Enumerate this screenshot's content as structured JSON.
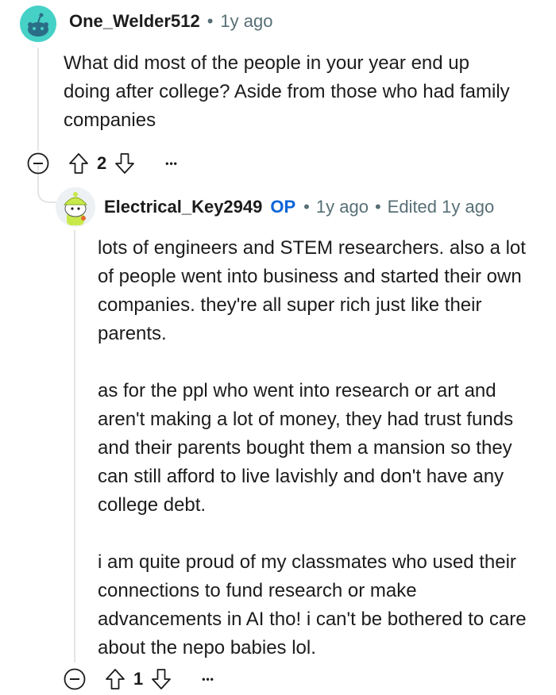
{
  "comment1": {
    "username": "One_Welder512",
    "separator": "•",
    "age": "1y ago",
    "body": "What did most of the people in your year end up doing after college? Aside from those who had family companies",
    "votes": "2",
    "more": "•••"
  },
  "comment2": {
    "username": "Electrical_Key2949",
    "op_badge": "OP",
    "separator": "•",
    "age": "1y ago",
    "separator2": "•",
    "edited": "Edited 1y ago",
    "paragraphs": [
      "lots of engineers and STEM researchers. also a lot of people went into business and started their own companies. they're all super rich just like their parents.",
      "as for the ppl who went into research or art and aren't making a lot of money, they had trust funds and their parents bought them a mansion so they can still afford to live lavishly and don't have any college debt.",
      "i am quite proud of my classmates who used their connections to fund research or make advancements in AI tho! i can't be bothered to care about the nepo babies lol."
    ],
    "votes": "1",
    "more": "•••"
  },
  "colors": {
    "avatar1_bg": "#46d1c6",
    "avatar1_face": "#2a6d86",
    "avatar2_hat": "#c7e94a",
    "op_blue": "#0a65d8",
    "meta_gray": "#576f76",
    "thread_line": "#e5e5e5"
  },
  "icons": [
    "collapse-icon",
    "upvote-icon",
    "downvote-icon",
    "more-options-icon",
    "snoo-avatar"
  ]
}
